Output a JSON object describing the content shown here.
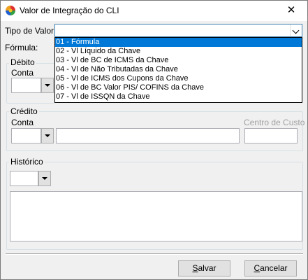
{
  "window": {
    "title": "Valor de Integração do CLI",
    "close_glyph": "✕"
  },
  "tipo_valor": {
    "label": "Tipo de Valor:",
    "value": "",
    "options": [
      "01 - Fórmula",
      "02 - Vl Líquido da Chave",
      "03 - Vl de BC de ICMS da Chave",
      "04 - Vl de Não Tributadas da Chave",
      "05 - Vl de ICMS dos Cupons da Chave",
      "06 - Vl de BC Valor PIS/ COFINS da Chave",
      "07 - Vl de ISSQN da Chave"
    ],
    "selected_index": 0
  },
  "formula": {
    "label": "Fórmula:"
  },
  "debito": {
    "title": "Débito",
    "conta_label": "Conta"
  },
  "credito": {
    "title": "Crédito",
    "conta_label": "Conta",
    "centro_custo_label": "Centro de Custo"
  },
  "historico": {
    "title": "Histórico"
  },
  "buttons": {
    "save": {
      "mnemonic": "S",
      "rest": "alvar"
    },
    "cancel": {
      "mnemonic": "C",
      "rest": "ancelar"
    }
  },
  "colors": {
    "selection": "#0078d7",
    "window_bg": "#f0f0f0",
    "disabled_text": "#a0a0a0"
  }
}
